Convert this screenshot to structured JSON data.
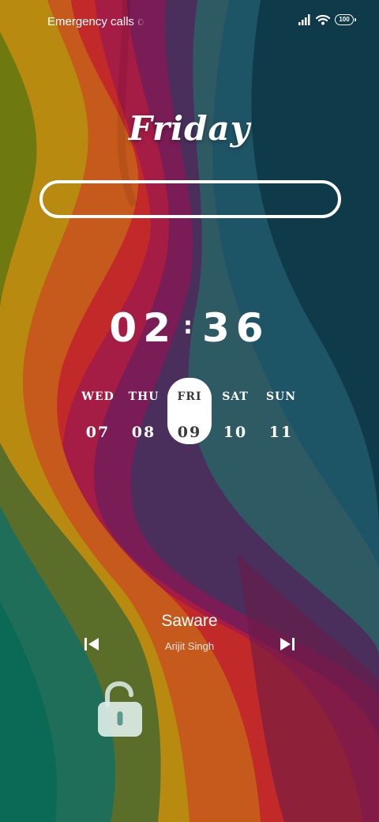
{
  "status_bar": {
    "carrier_text": "Emergency calls only",
    "battery_level": "100",
    "icons": [
      "signal-icon",
      "wifi-icon",
      "battery-icon"
    ]
  },
  "widget": {
    "day_name": "Friday",
    "time": {
      "hours": "02",
      "minutes": "36"
    },
    "week": [
      {
        "day": "WED",
        "date": "07",
        "selected": false
      },
      {
        "day": "THU",
        "date": "08",
        "selected": false
      },
      {
        "day": "FRI",
        "date": "09",
        "selected": true
      },
      {
        "day": "SAT",
        "date": "10",
        "selected": false
      },
      {
        "day": "SUN",
        "date": "11",
        "selected": false
      }
    ]
  },
  "media": {
    "title": "Saware",
    "artist": "Arijit Singh",
    "controls": [
      "previous-track-icon",
      "next-track-icon"
    ]
  },
  "lock": {
    "icon": "unlock-icon"
  },
  "colors": {
    "text": "#ffffff",
    "selected_day_bg": "#ffffff",
    "lock_tint": "#dfeeea"
  }
}
